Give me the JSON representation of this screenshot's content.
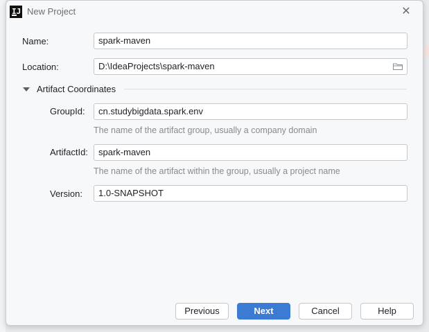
{
  "window": {
    "title": "New Project",
    "app_icon_text": "IJ"
  },
  "form": {
    "name": {
      "label": "Name:",
      "value": "spark-maven"
    },
    "location": {
      "label": "Location:",
      "value": "D:\\IdeaProjects\\spark-maven",
      "icon": "folder-icon"
    },
    "artifact_section": {
      "label": "Artifact Coordinates",
      "expanded": true
    },
    "group_id": {
      "label": "GroupId:",
      "value": "cn.studybigdata.spark.env",
      "hint": "The name of the artifact group, usually a company domain"
    },
    "artifact_id": {
      "label": "ArtifactId:",
      "value": "spark-maven",
      "hint": "The name of the artifact within the group, usually a project name"
    },
    "version": {
      "label": "Version:",
      "value": "1.0-SNAPSHOT"
    }
  },
  "buttons": {
    "previous": "Previous",
    "next": "Next",
    "cancel": "Cancel",
    "help": "Help"
  },
  "colors": {
    "primary_button": "#3b7bd4",
    "dialog_background": "#f7f8fa"
  }
}
